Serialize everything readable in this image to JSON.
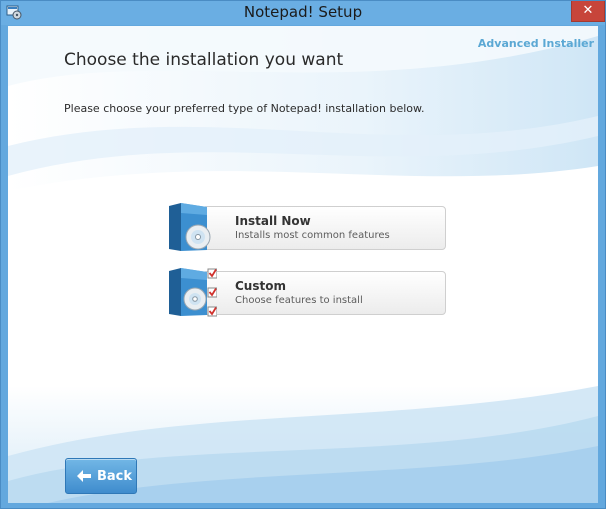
{
  "window": {
    "title": "Notepad! Setup",
    "close_glyph": "✕"
  },
  "header": {
    "title": "Choose the installation you want",
    "brand": "Advanced Installer",
    "subtitle": "Please choose your preferred type of Notepad! installation below."
  },
  "options": [
    {
      "title": "Install Now",
      "description": "Installs most common features",
      "icon": "install-box-icon"
    },
    {
      "title": "Custom",
      "description": "Choose features to install",
      "icon": "custom-box-checklist-icon"
    }
  ],
  "footer": {
    "back_label": "Back",
    "back_icon": "arrow-left-icon"
  },
  "colors": {
    "frame": "#6aaee3",
    "close": "#c7453a",
    "brand": "#5ba8d4",
    "button": "#4a97d4",
    "check": "#d0312d"
  }
}
